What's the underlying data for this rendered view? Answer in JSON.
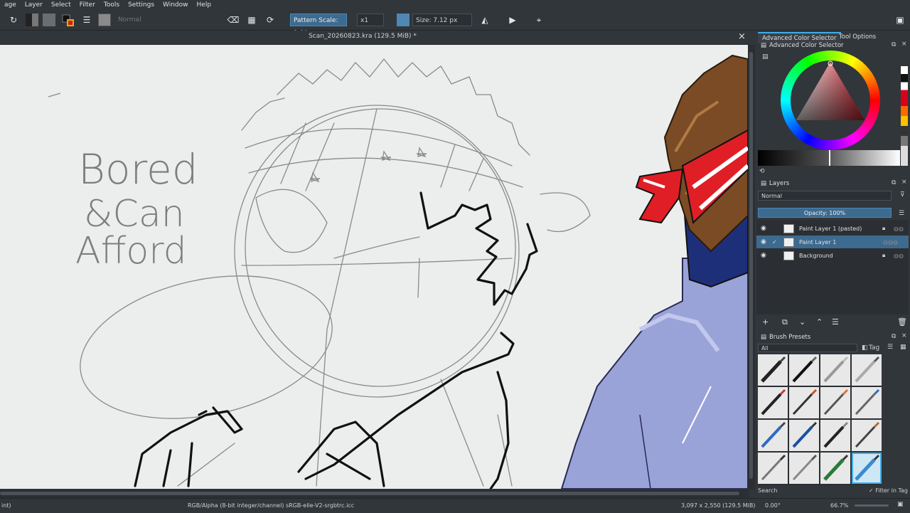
{
  "menu": [
    "age",
    "Layer",
    "Select",
    "Filter",
    "Tools",
    "Settings",
    "Window",
    "Help"
  ],
  "toolbar": {
    "blend_mode": "Normal",
    "pattern_scale": "Pattern Scale: 1.00x",
    "multiplier": "x1",
    "size": "Size: 7.12 px"
  },
  "document": {
    "title": "Scan_20260823.kra (129.5 MiB) *",
    "canvas_text": [
      "Bored",
      "&Can",
      "Afford"
    ]
  },
  "status": {
    "left": "int)",
    "color_profile": "RGB/Alpha (8-bit integer/channel)  sRGB-elle-V2-srgbtrc.icc",
    "image_size": "3,097 x 2,550 (129.5 MiB)",
    "rotation": "0.00°",
    "zoom": "66.7%"
  },
  "docker_tabs": [
    "Advanced Color Selector",
    "Tool Options"
  ],
  "color_selector": {
    "title": "Advanced Color Selector"
  },
  "layers": {
    "title": "Layers",
    "blend_mode": "Normal",
    "opacity": "Opacity: 100%",
    "items": [
      {
        "name": "Paint Layer 1 (pasted)",
        "selected": false
      },
      {
        "name": "Paint Layer 1",
        "selected": true
      },
      {
        "name": "Background",
        "selected": false
      }
    ]
  },
  "brushes": {
    "title": "Brush Presets",
    "filter": "All",
    "tag_label": "Tag",
    "search_label": "Search",
    "filter_in_tag": "Filter in Tag"
  },
  "colors": {
    "accent": "#3daee9",
    "selected_row": "#3d6a8f",
    "panel_bg": "#31363b"
  }
}
